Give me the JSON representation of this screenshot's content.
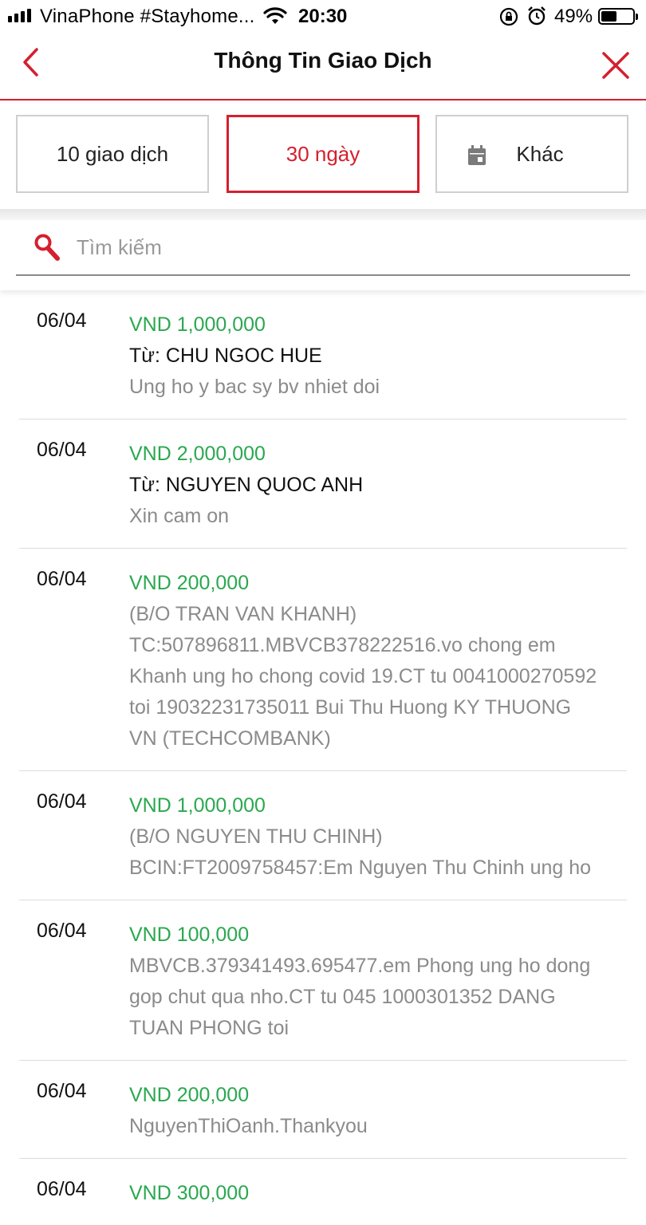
{
  "status_bar": {
    "carrier": "VinaPhone #Stayhome...",
    "time": "20:30",
    "battery_percent_label": "49%",
    "battery_level": 0.49
  },
  "header": {
    "title": "Thông Tin Giao Dịch",
    "accent_color": "#d4202e"
  },
  "filters": {
    "items": [
      {
        "label": "10 giao dịch",
        "selected": false
      },
      {
        "label": "30 ngày",
        "selected": true
      },
      {
        "label": "Khác",
        "selected": false,
        "icon": "calendar-icon"
      }
    ]
  },
  "search": {
    "placeholder": "Tìm kiếm",
    "value": ""
  },
  "transactions": [
    {
      "date": "06/04",
      "amount": "VND 1,000,000",
      "from": "Từ: CHU NGOC HUE",
      "desc": "Ung ho y bac sy bv nhiet doi"
    },
    {
      "date": "06/04",
      "amount": "VND 2,000,000",
      "from": "Từ: NGUYEN QUOC ANH",
      "desc": "Xin cam on"
    },
    {
      "date": "06/04",
      "amount": "VND 200,000",
      "from": "",
      "desc": "(B/O TRAN VAN KHANH)\nTC:507896811.MBVCB378222516.vo chong em\nKhanh ung ho chong covid 19.CT tu 0041000270592\ntoi 19032231735011 Bui Thu Huong KY THUONG\nVN (TECHCOMBANK)"
    },
    {
      "date": "06/04",
      "amount": "VND 1,000,000",
      "from": "",
      "desc": "(B/O NGUYEN THU CHINH)\nBCIN:FT2009758457:Em Nguyen Thu Chinh ung ho"
    },
    {
      "date": "06/04",
      "amount": "VND 100,000",
      "from": "",
      "desc": "MBVCB.379341493.695477.em Phong ung ho dong\ngop chut qua nho.CT tu 045 1000301352 DANG\nTUAN PHONG toi"
    },
    {
      "date": "06/04",
      "amount": "VND 200,000",
      "from": "",
      "desc": "NguyenThiOanh.Thankyou"
    },
    {
      "date": "06/04",
      "amount": "VND 300,000",
      "from": "",
      "desc": ""
    }
  ],
  "colors": {
    "amount_green": "#2aa84f",
    "desc_gray": "#8b8b8b"
  }
}
